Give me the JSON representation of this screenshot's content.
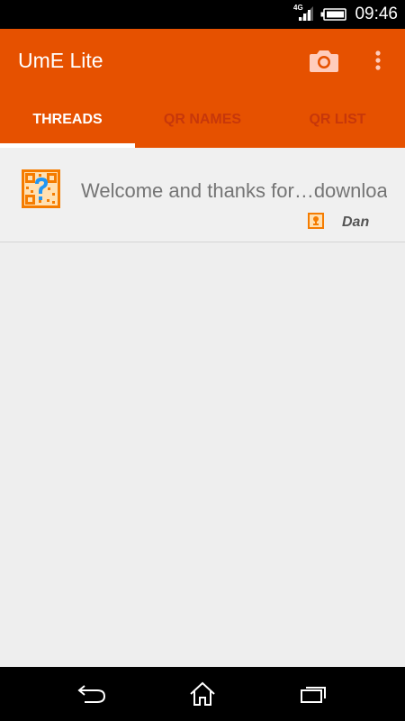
{
  "status_bar": {
    "network": "4G",
    "time": "09:46"
  },
  "app_bar": {
    "title": "UmE Lite",
    "actions": [
      {
        "icon": "camera-icon"
      },
      {
        "icon": "overflow-menu-icon"
      }
    ]
  },
  "tabs": [
    {
      "label": "THREADS",
      "active": true
    },
    {
      "label": "QR NAMES",
      "active": false
    },
    {
      "label": "QR LIST",
      "active": false
    }
  ],
  "threads": [
    {
      "message": "Welcome and thanks for…downloading",
      "sender": "Dan",
      "avatar_icon": "qr-question-icon",
      "sender_icon": "person-badge-icon"
    }
  ],
  "nav": [
    {
      "icon": "back-icon"
    },
    {
      "icon": "home-icon"
    },
    {
      "icon": "recents-icon"
    }
  ],
  "colors": {
    "primary": "#e65100",
    "tab_inactive": "#c7370a",
    "qr_orange": "#f57c00",
    "qr_question": "#2196f3"
  }
}
